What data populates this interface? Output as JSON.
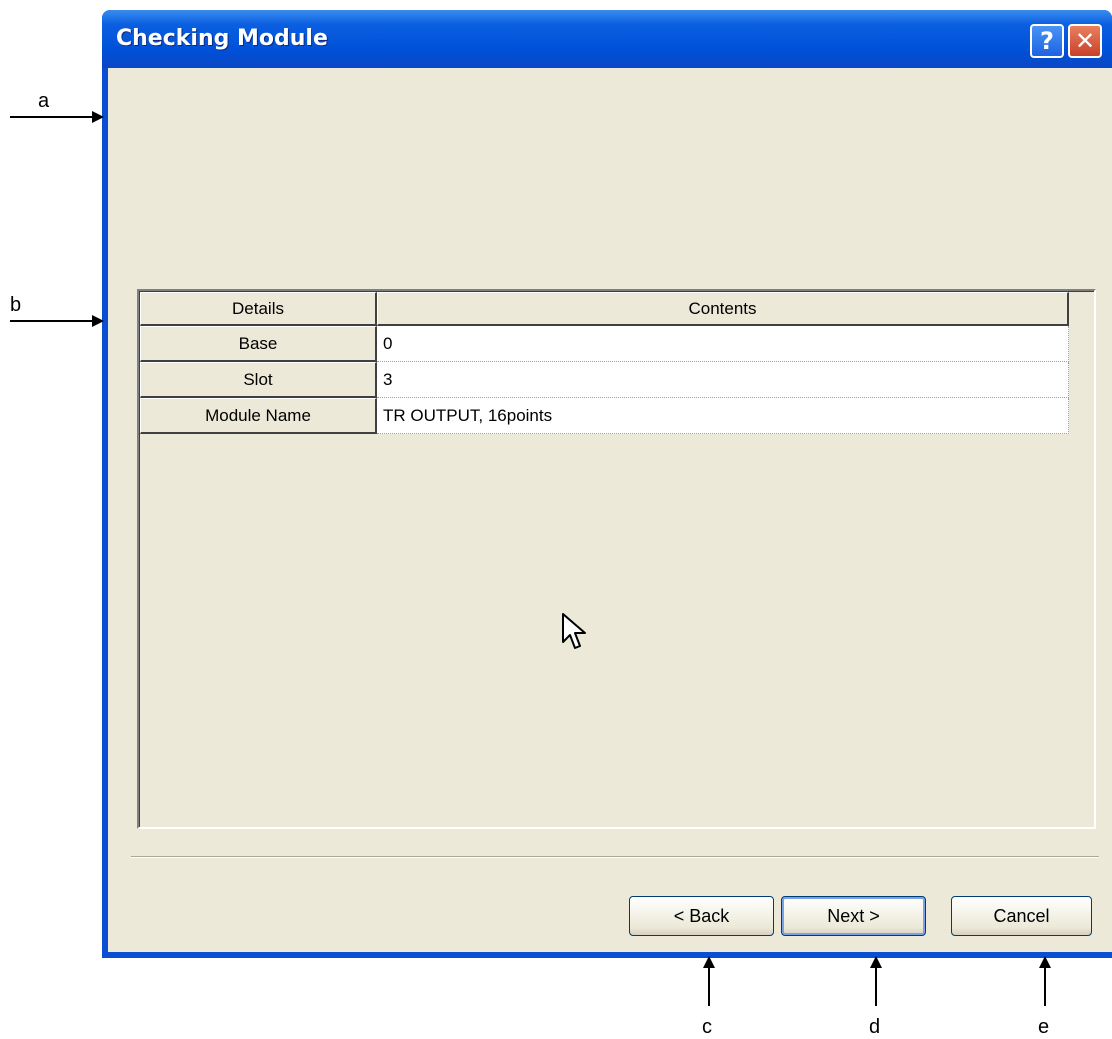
{
  "window": {
    "title": "Checking Module",
    "help_button": "?",
    "close_button": "✕"
  },
  "table": {
    "headers": [
      "Details",
      "Contents"
    ],
    "rows": [
      {
        "label": "Base",
        "value": "0"
      },
      {
        "label": "Slot",
        "value": "3"
      },
      {
        "label": "Module Name",
        "value": "TR OUTPUT, 16points"
      }
    ]
  },
  "buttons": {
    "back": "< Back",
    "next": "Next >",
    "cancel": "Cancel"
  },
  "annotations": {
    "a": "a",
    "b": "b",
    "c": "c",
    "d": "d",
    "e": "e"
  },
  "icons": {
    "help": "question-mark-icon",
    "close": "close-icon",
    "cursor": "mouse-pointer-icon"
  }
}
